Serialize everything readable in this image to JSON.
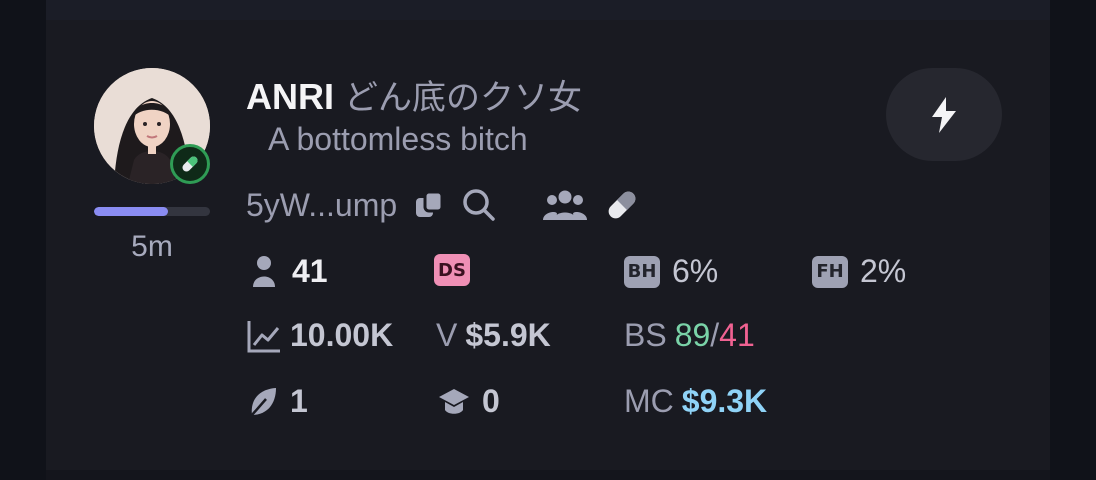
{
  "token": {
    "symbol": "ANRI",
    "name": "どん底のクソ女",
    "subtitle": "A bottomless bitch",
    "address_short": "5yW...ump",
    "age": "5m",
    "progress_fraction": 0.64
  },
  "stats": {
    "holders": "41",
    "ds_label": "DS",
    "bh_label": "BH",
    "bh_value": "6%",
    "fh_label": "FH",
    "fh_value": "2%",
    "volume_chart_value": "10.00K",
    "v_label": "V",
    "v_value": "$5.9K",
    "bs_label": "BS",
    "bs_buys": "89",
    "bs_sep": "/",
    "bs_sells": "41",
    "leaf_count": "1",
    "grad_count": "0",
    "mc_label": "MC",
    "mc_value": "$9.3K"
  },
  "colors": {
    "progress": "#8a8cf2",
    "buys": "#7ad3a8",
    "sells": "#f06292",
    "market_cap": "#8fd3f7",
    "pill_border": "#2f9c55"
  },
  "icons": [
    "pill-icon",
    "copy-icon",
    "search-icon",
    "users-icon",
    "lightning-icon",
    "person-icon",
    "chart-line-icon",
    "leaf-icon",
    "graduation-cap-icon"
  ]
}
